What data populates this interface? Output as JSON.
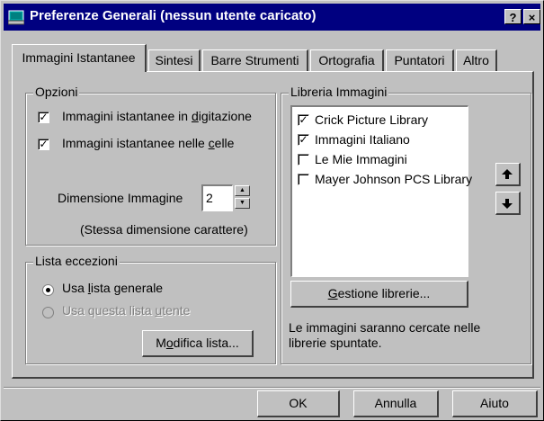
{
  "window": {
    "title": "Preferenze Generali  (nessun utente caricato)",
    "help_label": "?",
    "close_label": "×"
  },
  "tabs": [
    {
      "label": "Immagini Istantanee",
      "active": true
    },
    {
      "label": "Sintesi",
      "active": false
    },
    {
      "label": "Barre Strumenti",
      "active": false
    },
    {
      "label": "Ortografia",
      "active": false
    },
    {
      "label": "Puntatori",
      "active": false
    },
    {
      "label": "Altro",
      "active": false
    }
  ],
  "opzioni": {
    "title": "Opzioni",
    "checkbox1": {
      "pre": "Immagini istantanee in ",
      "key": "d",
      "post": "igitazione",
      "checked": true
    },
    "checkbox2": {
      "pre": "Immagini istantanee nelle ",
      "key": "c",
      "post": "elle",
      "checked": true
    },
    "size_label": "Dimensione Immagine",
    "size_value": "2",
    "size_note": "(Stessa dimensione carattere)"
  },
  "lista_eccezioni": {
    "title": "Lista eccezioni",
    "radio1": {
      "pre": "Usa ",
      "key": "l",
      "post": "ista generale",
      "selected": true,
      "enabled": true
    },
    "radio2": {
      "pre": "Usa questa lista ",
      "key": "u",
      "post": "tente",
      "selected": false,
      "enabled": false
    },
    "edit_button": {
      "pre": "M",
      "key": "o",
      "post": "difica lista..."
    }
  },
  "libreria": {
    "title": "Libreria Immagini",
    "items": [
      {
        "label": "Crick Picture Library",
        "checked": true
      },
      {
        "label": "Immagini Italiano",
        "checked": true
      },
      {
        "label": "Le Mie Immagini",
        "checked": false
      },
      {
        "label": "Mayer Johnson PCS Library",
        "checked": false
      }
    ],
    "manage_button": {
      "key": "G",
      "post": "estione librerie..."
    },
    "note_line1": "Le immagini saranno cercate nelle",
    "note_line2": "librerie spuntate.",
    "up_icon": "arrow-up-icon",
    "down_icon": "arrow-down-icon"
  },
  "footer": {
    "ok": "OK",
    "cancel": "Annulla",
    "help": "Aiuto"
  },
  "colors": {
    "titlebar": "#000080",
    "face": "#c0c0c0"
  }
}
